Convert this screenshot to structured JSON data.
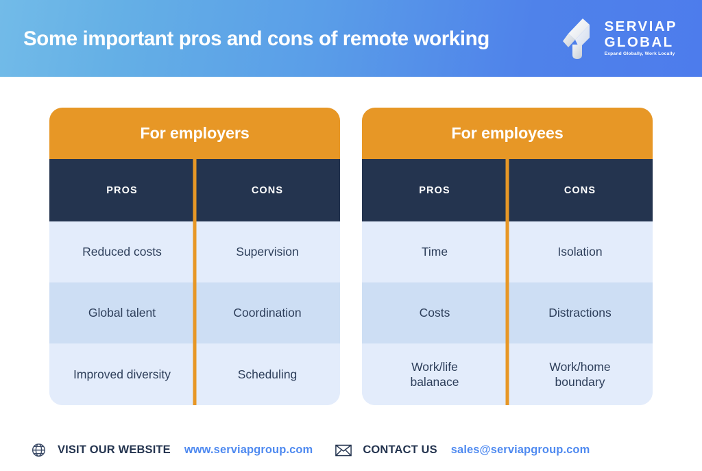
{
  "header": {
    "title": "Some important pros and cons of remote working",
    "gradient_from": "#72bbe8",
    "gradient_to": "#4d7cec",
    "logo": {
      "name_line1": "SERVIAP",
      "name_line2": "GLOBAL",
      "tagline": "Expand Globally, Work Locally",
      "mark_icon": "serviap-ribbon-logo-icon"
    }
  },
  "colors": {
    "orange": "#e79726",
    "navy": "#24344f",
    "row_light": "#e3ecfb",
    "row_dark": "#cddef4",
    "text_body": "#2d3e5a",
    "link_blue": "#4f8af0"
  },
  "tables": [
    {
      "title": "For employers",
      "columns": [
        "PROS",
        "CONS"
      ],
      "rows": [
        {
          "pros": "Reduced costs",
          "cons": "Supervision"
        },
        {
          "pros": "Global talent",
          "cons": "Coordination"
        },
        {
          "pros": "Improved diversity",
          "cons": "Scheduling"
        }
      ]
    },
    {
      "title": "For employees",
      "columns": [
        "PROS",
        "CONS"
      ],
      "rows": [
        {
          "pros": "Time",
          "cons": "Isolation"
        },
        {
          "pros": "Costs",
          "cons": "Distractions"
        },
        {
          "pros": "Work/life\nbalanace",
          "cons": "Work/home\nboundary"
        }
      ]
    }
  ],
  "footer": {
    "website": {
      "icon": "globe-icon",
      "label": "VISIT OUR WEBSITE",
      "value": "www.serviapgroup.com"
    },
    "contact": {
      "icon": "envelope-icon",
      "label": "CONTACT US",
      "value": "sales@serviapgroup.com"
    }
  }
}
